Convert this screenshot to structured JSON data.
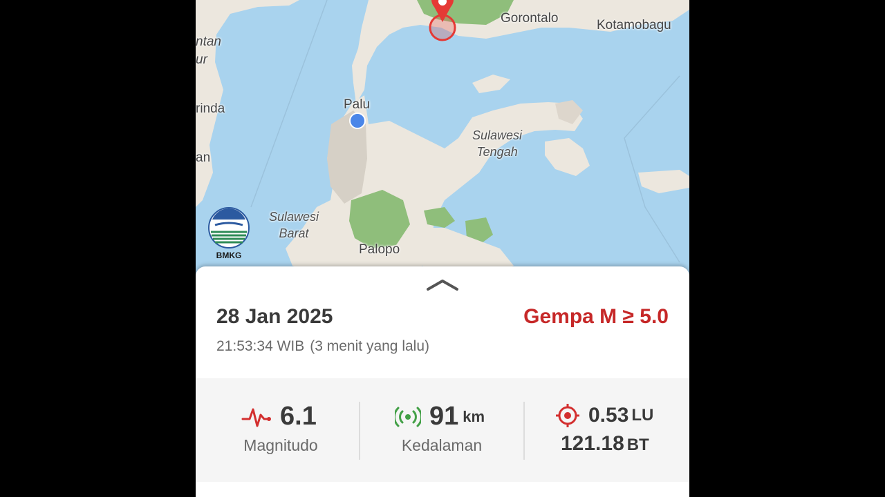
{
  "map": {
    "labels": {
      "gorontalo": "Gorontalo",
      "kotamobagu": "Kotamobagu",
      "palu": "Palu",
      "sulawesi_tengah_1": "Sulawesi",
      "sulawesi_tengah_2": "Tengah",
      "sulawesi_barat_1": "Sulawesi",
      "sulawesi_barat_2": "Barat",
      "palopo": "Palopo",
      "partial_1": "ntan",
      "partial_2": "ur",
      "partial_3": "rinda",
      "partial_4": "an"
    },
    "logo_text": "BMKG",
    "colors": {
      "sea": "#a9d3ee",
      "land": "#ece7de",
      "forest": "#8fbe7b",
      "marker": "#e53935"
    }
  },
  "quake": {
    "date": "28 Jan 2025",
    "time": "21:53:34 WIB",
    "relative": "(3 menit yang lalu)",
    "category": "Gempa M ≥ 5.0",
    "magnitude": {
      "value": "6.1",
      "label": "Magnitudo"
    },
    "depth": {
      "value": "91",
      "unit": "km",
      "label": "Kedalaman"
    },
    "location": {
      "lat_value": "0.53",
      "lat_unit": "LU",
      "lon_value": "121.18",
      "lon_unit": "BT"
    }
  },
  "icons": {
    "handle": "chevron-up-icon",
    "magnitude": "pulse-icon",
    "depth": "signal-waves-icon",
    "location": "target-icon",
    "epicenter": "map-pin-icon"
  }
}
